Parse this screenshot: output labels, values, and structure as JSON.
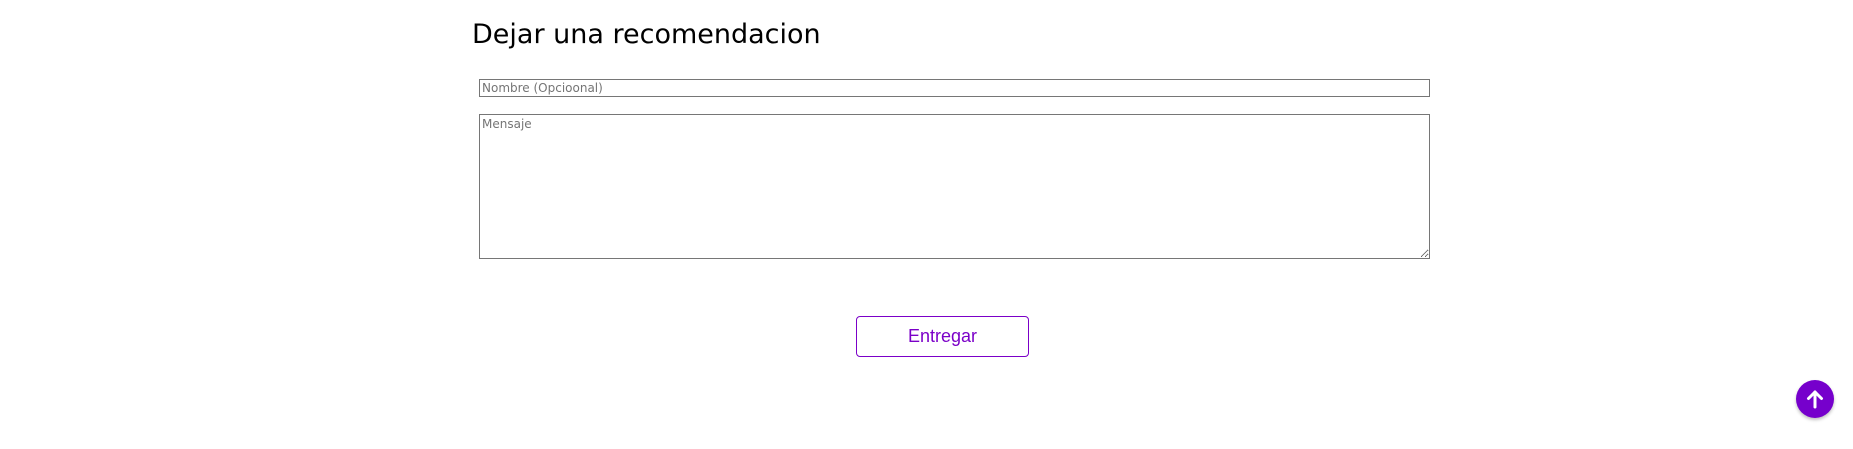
{
  "form": {
    "title": "Dejar una recomendacion",
    "name_placeholder": "Nombre (Opcioonal)",
    "name_value": "",
    "message_placeholder": "Mensaje",
    "message_value": "",
    "submit_label": "Entregar"
  },
  "scroll_top": {
    "icon": "arrow-up-icon"
  },
  "colors": {
    "accent": "#7b00c8",
    "scroll_button": "#7600cc"
  }
}
